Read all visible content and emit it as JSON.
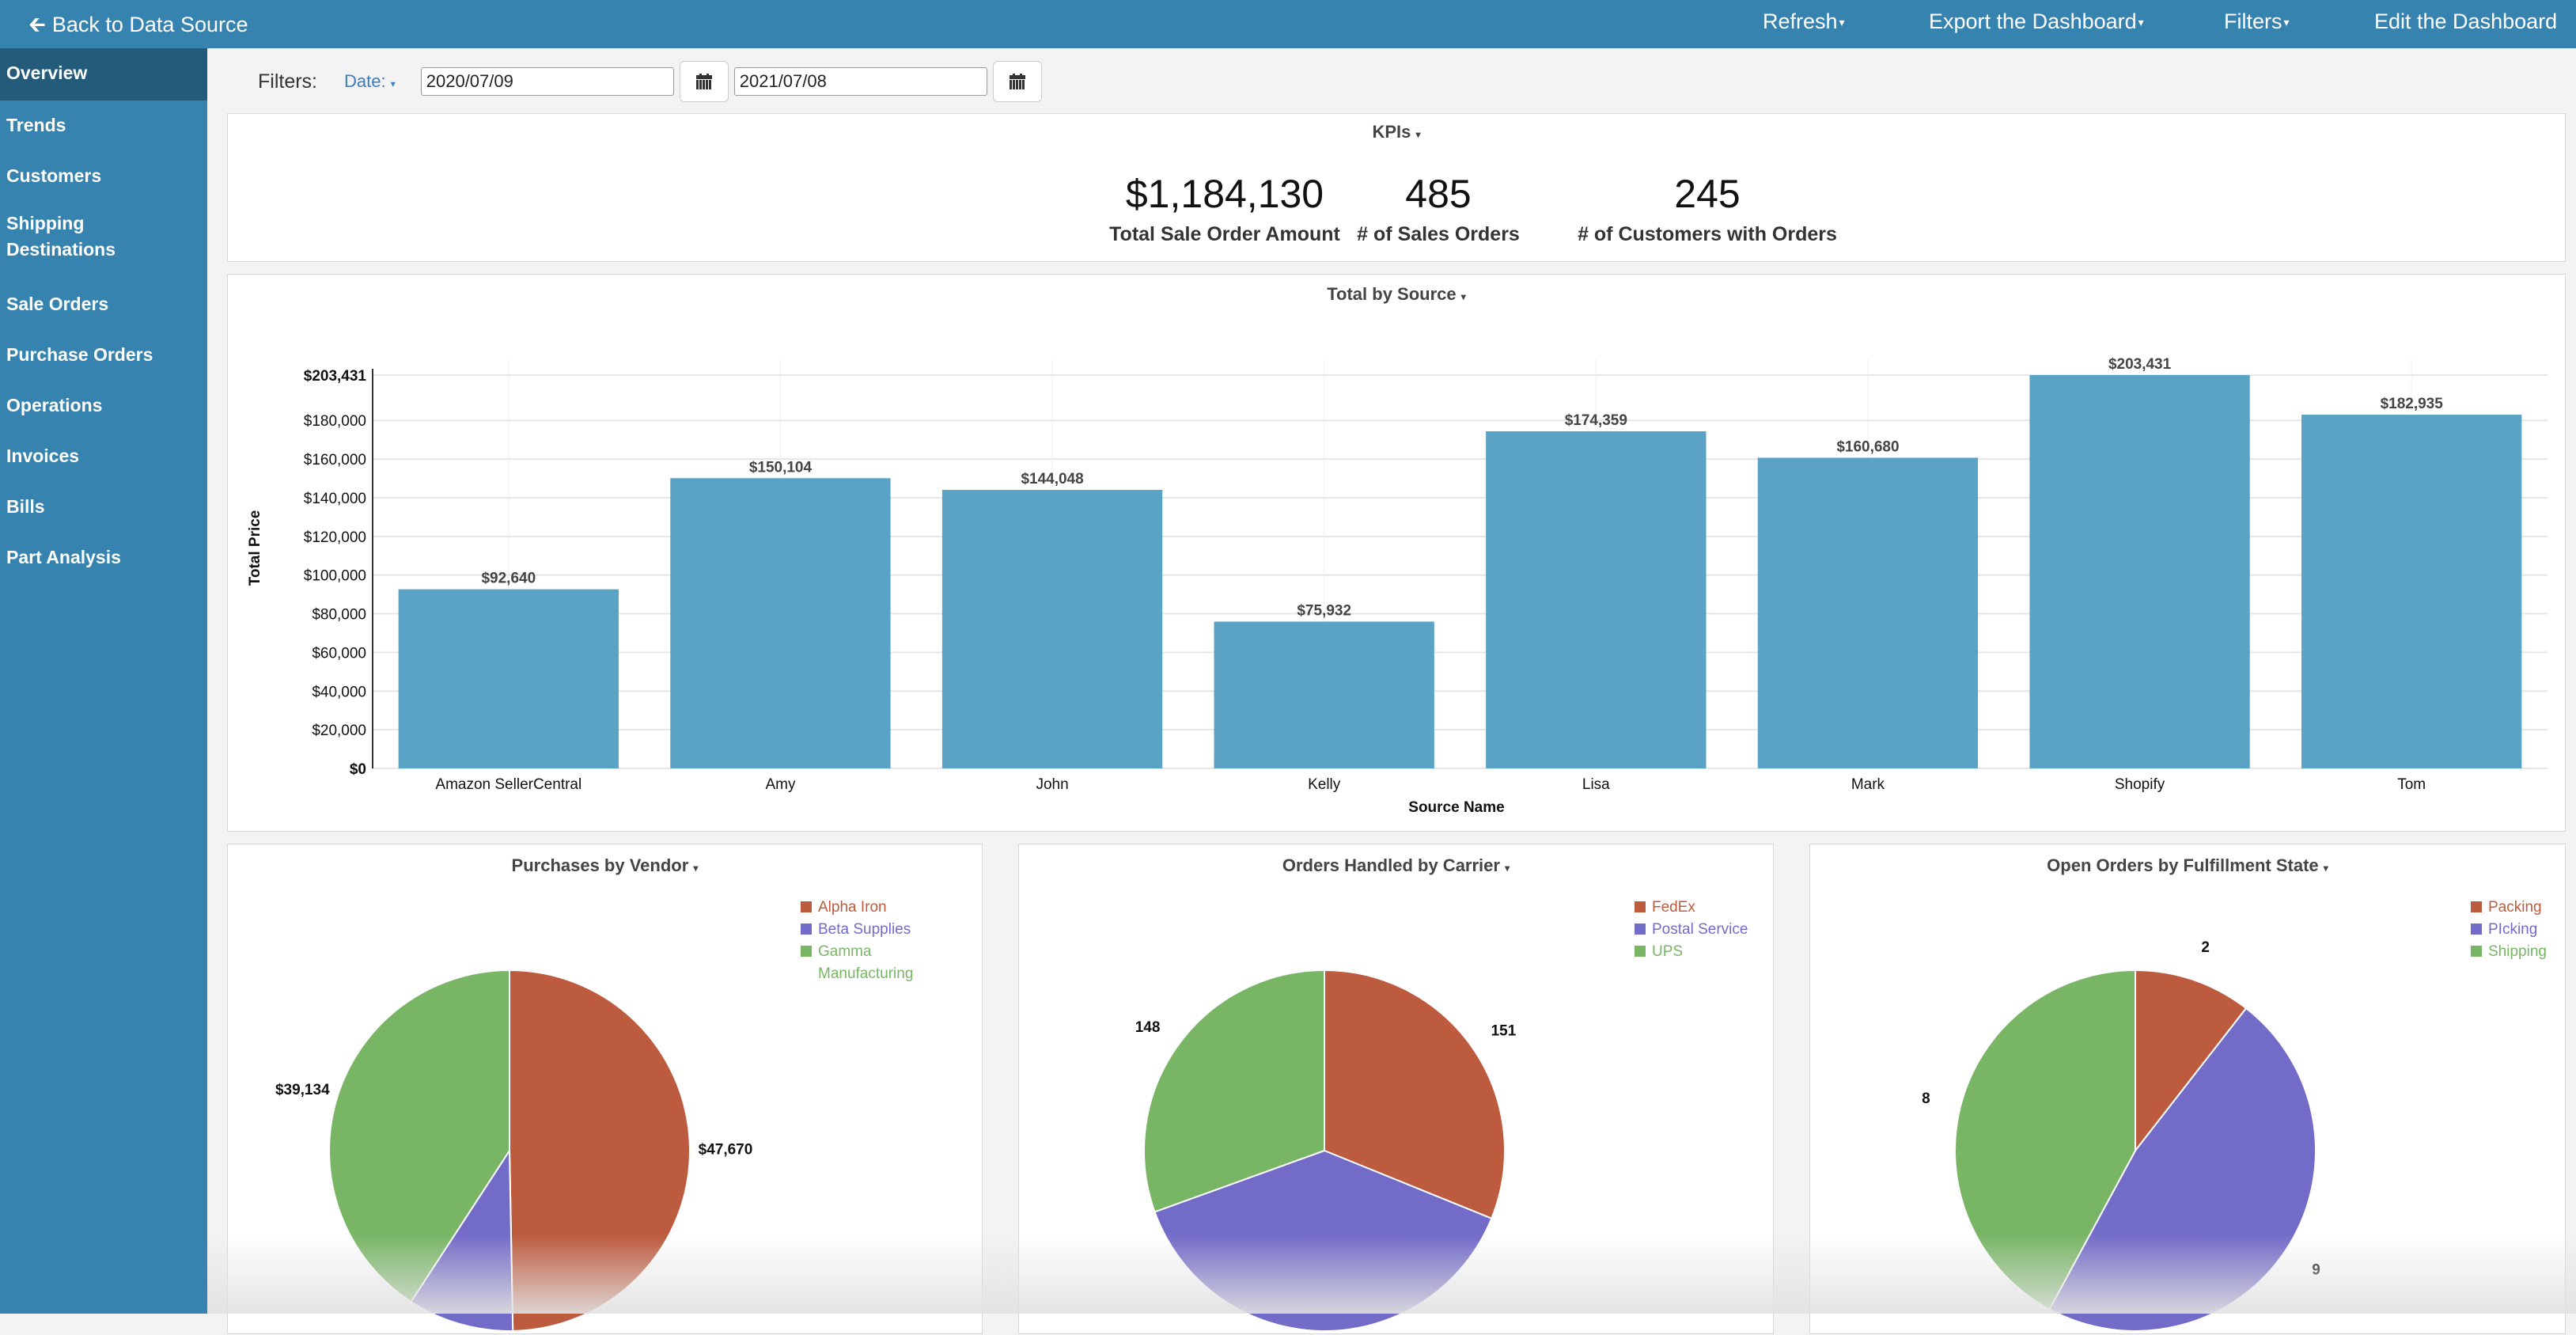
{
  "topbar": {
    "back_label": "Back to Data Source",
    "refresh_label": "Refresh",
    "export_label": "Export the Dashboard",
    "filters_label": "Filters",
    "edit_label": "Edit the Dashboard",
    "background": "#3783b0"
  },
  "sidebar": {
    "items": [
      {
        "label": "Overview",
        "active": true
      },
      {
        "label": "Trends"
      },
      {
        "label": "Customers"
      },
      {
        "label": "Shipping Destinations"
      },
      {
        "label": "Sale Orders"
      },
      {
        "label": "Purchase Orders"
      },
      {
        "label": "Operations"
      },
      {
        "label": "Invoices"
      },
      {
        "label": "Bills"
      },
      {
        "label": "Part Analysis"
      }
    ]
  },
  "filters": {
    "label": "Filters:",
    "date_label": "Date:",
    "start_date": "2020/07/09",
    "end_date": "2021/07/08"
  },
  "kpis": {
    "title": "KPIs",
    "items": [
      {
        "value": "$1,184,130",
        "label": "Total Sale Order Amount"
      },
      {
        "value": "485",
        "label": "# of Sales Orders"
      },
      {
        "value": "245",
        "label": "# of Customers with Orders"
      }
    ]
  },
  "chart_data": [
    {
      "type": "bar",
      "title": "Total by Source",
      "xlabel": "Source Name",
      "ylabel": "Total Price",
      "categories": [
        "Amazon SellerCentral",
        "Amy",
        "John",
        "Kelly",
        "Lisa",
        "Mark",
        "Shopify",
        "Tom"
      ],
      "values": [
        92640,
        150104,
        144048,
        75932,
        174359,
        160680,
        203431,
        182935
      ],
      "value_labels": [
        "$92,640",
        "$150,104",
        "$144,048",
        "$75,932",
        "$174,359",
        "$160,680",
        "$203,431",
        "$182,935"
      ],
      "ylim": [
        0,
        203431
      ],
      "yticks": [
        0,
        20000,
        40000,
        60000,
        80000,
        100000,
        120000,
        140000,
        160000,
        180000,
        203431
      ],
      "ytick_labels": [
        "$0",
        "$20,000",
        "$40,000",
        "$60,000",
        "$80,000",
        "$100,000",
        "$120,000",
        "$140,000",
        "$160,000",
        "$180,000",
        "$203,431"
      ],
      "grid": true,
      "color": "#5ba3c5"
    },
    {
      "type": "pie",
      "title": "Purchases by Vendor",
      "labels": [
        "Alpha Iron",
        "Beta Supplies",
        "Gamma Manufacturing"
      ],
      "values": [
        47670,
        9100,
        39134
      ],
      "value_labels": [
        "$47,670",
        "",
        "$39,134"
      ],
      "colors": [
        "#bd5b3f",
        "#736bc8",
        "#78b665"
      ],
      "legend": "top-right"
    },
    {
      "type": "pie",
      "title": "Orders Handled by Carrier",
      "labels": [
        "FedEx",
        "Postal Service",
        "UPS"
      ],
      "values": [
        151,
        186,
        148
      ],
      "value_labels": [
        "151",
        "",
        "148"
      ],
      "colors": [
        "#bd5b3f",
        "#736bc8",
        "#78b665"
      ],
      "legend": "top-right"
    },
    {
      "type": "pie",
      "title": "Open Orders by Fulfillment State",
      "labels": [
        "Packing",
        "PIcking",
        "Shipping"
      ],
      "values": [
        2,
        9,
        8
      ],
      "value_labels": [
        "2",
        "9",
        "8"
      ],
      "colors": [
        "#bd5b3f",
        "#736bc8",
        "#78b665"
      ],
      "legend": "top-right"
    }
  ]
}
